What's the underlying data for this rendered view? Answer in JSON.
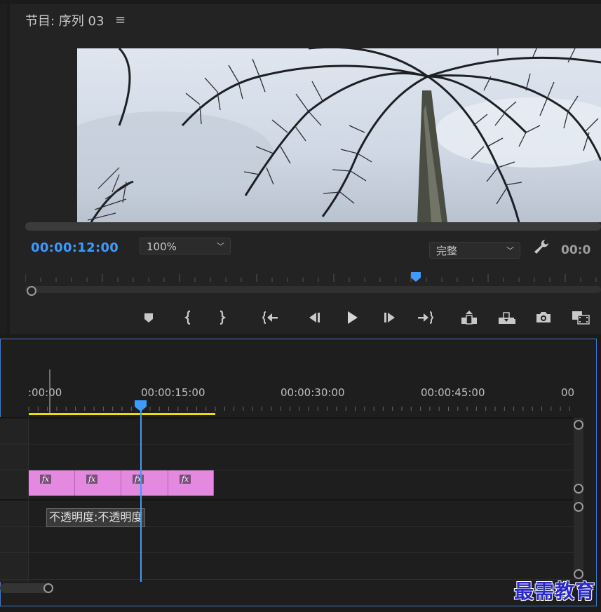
{
  "program_monitor": {
    "title": "节目: 序列 03",
    "menu_icon": "hamburger-menu-icon",
    "timecode": "00:00:12:00",
    "zoom": "100%",
    "quality": "完整",
    "timecode_right": "00:0",
    "transport_icons": [
      "add-marker-icon",
      "mark-in-icon",
      "mark-out-icon",
      "go-to-in-icon",
      "step-back-icon",
      "play-icon",
      "step-forward-icon",
      "go-to-out-icon",
      "lift-icon",
      "extract-icon",
      "export-frame-icon",
      "button-editor-icon"
    ]
  },
  "timeline": {
    "ruler_labels": [
      ":00:00",
      "00:00:15:00",
      "00:00:30:00",
      "00:00:45:00",
      "00"
    ],
    "tooltip": "不透明度:不透明度",
    "clip_badge": "fx",
    "clip_count": 4
  },
  "watermark": "最需教育",
  "colors": {
    "accent_blue": "#3d9bff",
    "clip_pink": "#e38ae0",
    "work_area_yellow": "#e8e000",
    "panel_border": "#3c7ed1"
  }
}
